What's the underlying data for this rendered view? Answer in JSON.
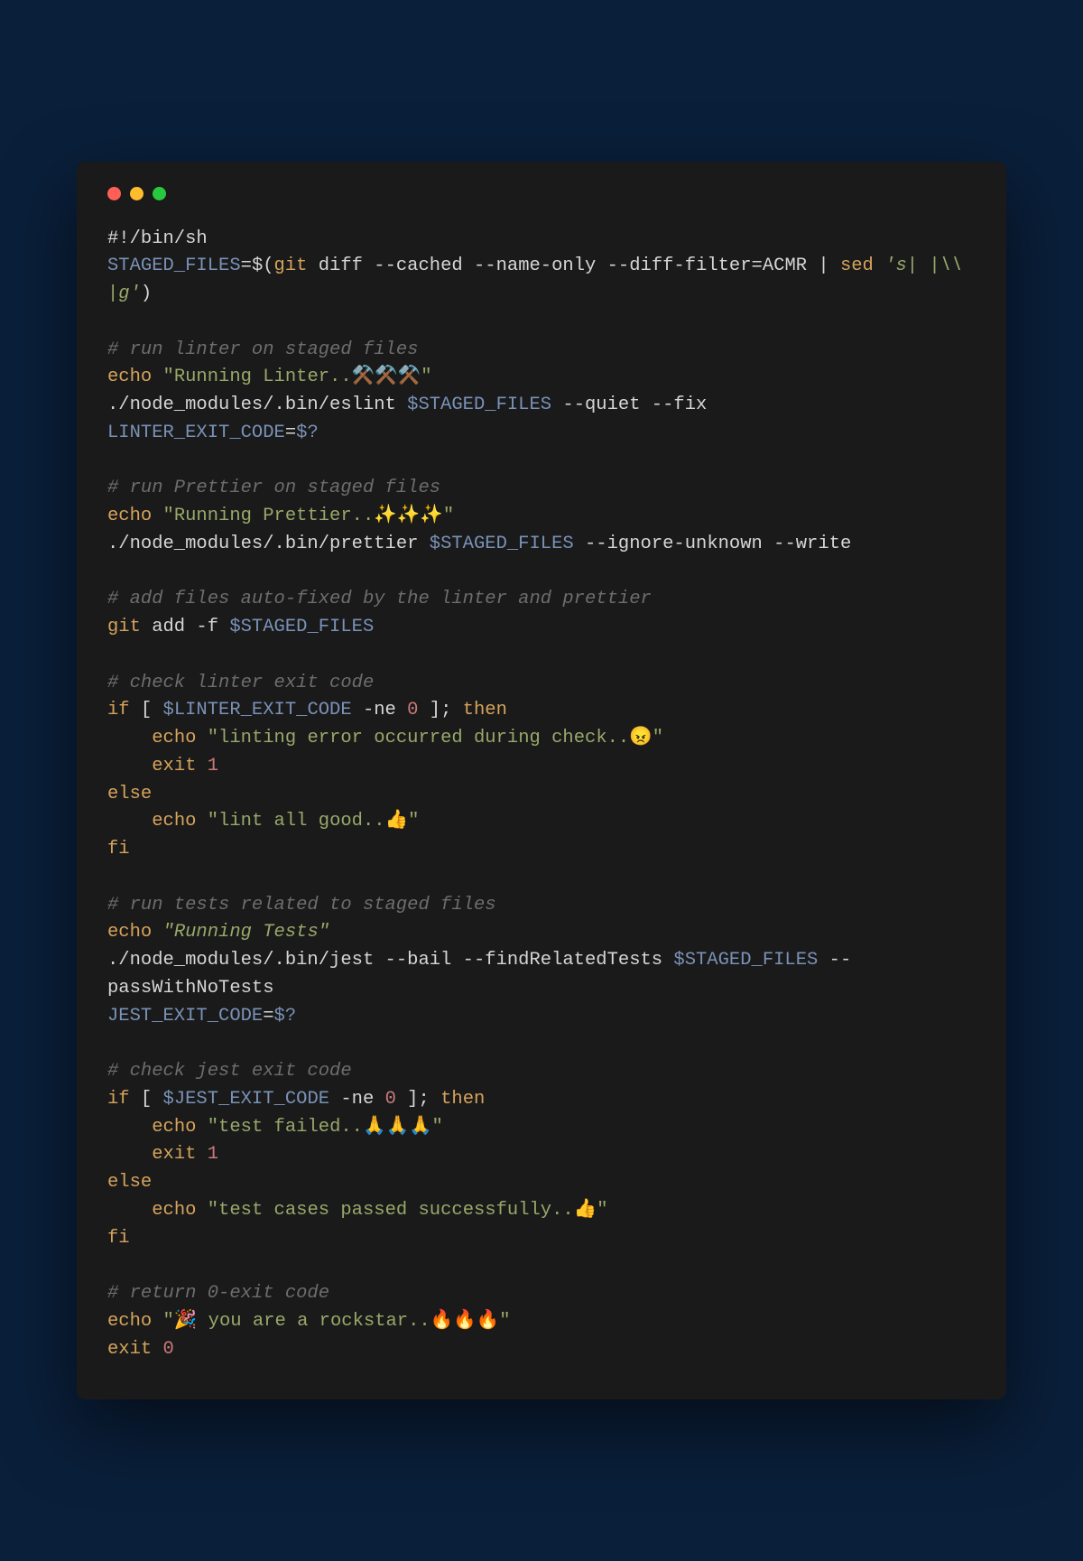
{
  "shebang": "#!/bin/sh",
  "vars": {
    "staged": "STAGED_FILES",
    "linterExit": "LINTER_EXIT_CODE",
    "jestExit": "JEST_EXIT_CODE",
    "stagedRef": "$STAGED_FILES",
    "linterExitRef": "$LINTER_EXIT_CODE",
    "jestExitRef": "$JEST_EXIT_CODE",
    "qmark": "$?"
  },
  "cmds": {
    "git": "git",
    "echo": "echo",
    "sed": "sed",
    "exit": "exit"
  },
  "kw": {
    "if": "if",
    "then": "then",
    "else": "else",
    "fi": "fi"
  },
  "ops": {
    "eq": "=",
    "dollarOpen": "$(",
    "close": ")",
    "pipe": " | ",
    "lbracket": " [ ",
    "rbracket": " ]; ",
    "ne": " -ne "
  },
  "nums": {
    "zero": "0",
    "one": "1"
  },
  "lines": {
    "gitDiff": " diff --cached --name-only --diff-filter=ACMR",
    "sedExpr": "'s| |\\\\ |g'",
    "comment1": "# run linter on staged files",
    "echoLinter": "\"Running Linter..⚒️⚒️⚒️\"",
    "eslint": "./node_modules/.bin/eslint ",
    "eslintFlags": " --quiet --fix",
    "comment2": "# run Prettier on staged files",
    "echoPrettier": "\"Running Prettier..✨✨✨\"",
    "prettier": "./node_modules/.bin/prettier ",
    "prettierFlags": " --ignore-unknown --write",
    "comment3": "# add files auto-fixed by the linter and prettier",
    "gitAdd": " add -f ",
    "comment4": "# check linter exit code",
    "echoLintErr": "\"linting error occurred during check..😠\"",
    "echoLintOk": "\"lint all good..👍\"",
    "comment5": "# run tests related to staged files",
    "echoTests": "\"Running Tests\"",
    "jest": "./node_modules/.bin/jest --bail --findRelatedTests ",
    "jestFlags": " --passWithNoTests",
    "comment6": "# check jest exit code",
    "echoTestFail": "\"test failed..🙏🙏🙏\"",
    "echoTestOk": "\"test cases passed successfully..👍\"",
    "comment7": "# return 0-exit code",
    "echoRockstar": "\"🎉 you are a rockstar..🔥🔥🔥\""
  }
}
